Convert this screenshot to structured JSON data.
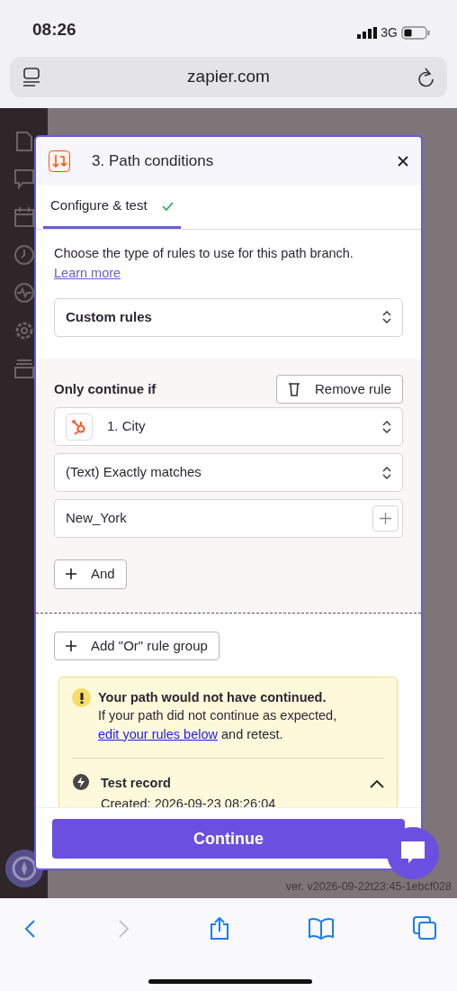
{
  "status_bar": {
    "time": "08:26",
    "network": "3G"
  },
  "address_bar": {
    "url": "zapier.com"
  },
  "background": {
    "version": "ver. v2026-09-22t23:45-1ebcf028"
  },
  "modal": {
    "step_title": "3. Path conditions",
    "tabs": [
      {
        "label": "Configure & test",
        "selected": true,
        "complete": true
      }
    ],
    "intro": "Choose the type of rules to use for this path branch.",
    "learn_more": "Learn more",
    "rule_type": "Custom rules",
    "group": {
      "heading": "Only continue if",
      "remove_button": "Remove rule",
      "field": "1. City",
      "condition": "(Text) Exactly matches",
      "value": "New_York",
      "and_button": "And"
    },
    "or_button": "Add \"Or\" rule group",
    "alert": {
      "title": "Your path would not have continued.",
      "message_before": "If your path did not continue as expected, ",
      "link": "edit your rules below",
      "message_after": " and retest."
    },
    "test_record": {
      "title": "Test record",
      "created": "Created: 2026-09-23 08:26:04",
      "expanded": true
    },
    "continue_button": "Continue"
  },
  "toolbar": {
    "buttons": [
      {
        "kind": "back",
        "disabled": false
      },
      {
        "kind": "forward",
        "disabled": true
      },
      {
        "kind": "share",
        "disabled": false
      },
      {
        "kind": "bookmarks",
        "disabled": false
      },
      {
        "kind": "tabs",
        "disabled": false
      }
    ]
  }
}
